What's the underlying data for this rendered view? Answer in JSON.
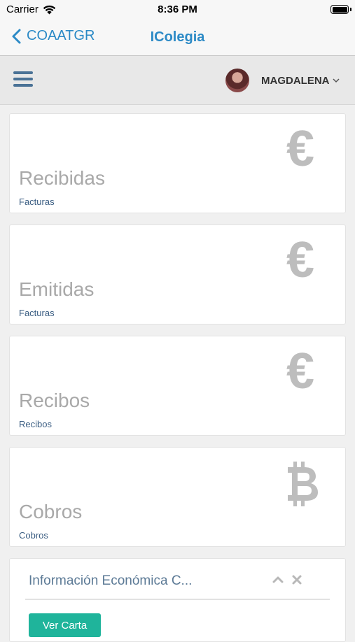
{
  "status_bar": {
    "carrier": "Carrier",
    "time": "8:36 PM"
  },
  "nav": {
    "back_label": "COAATGR",
    "title": "IColegia",
    "accent_color": "#2c8ac6"
  },
  "toolbar": {
    "user_name": "MAGDALENA",
    "menu_icon": "hamburger-icon"
  },
  "cards": [
    {
      "title": "Recibidas",
      "subtitle": "Facturas",
      "icon": "euro-icon",
      "glyph": "€"
    },
    {
      "title": "Emitidas",
      "subtitle": "Facturas",
      "icon": "euro-icon",
      "glyph": "€"
    },
    {
      "title": "Recibos",
      "subtitle": "Recibos",
      "icon": "euro-icon",
      "glyph": "€"
    },
    {
      "title": "Cobros",
      "subtitle": "Cobros",
      "icon": "bitcoin-icon",
      "glyph": "B"
    }
  ],
  "info_panel": {
    "title": "Información Económica C...",
    "button_label": "Ver Carta",
    "button_color": "#1fb49b"
  }
}
